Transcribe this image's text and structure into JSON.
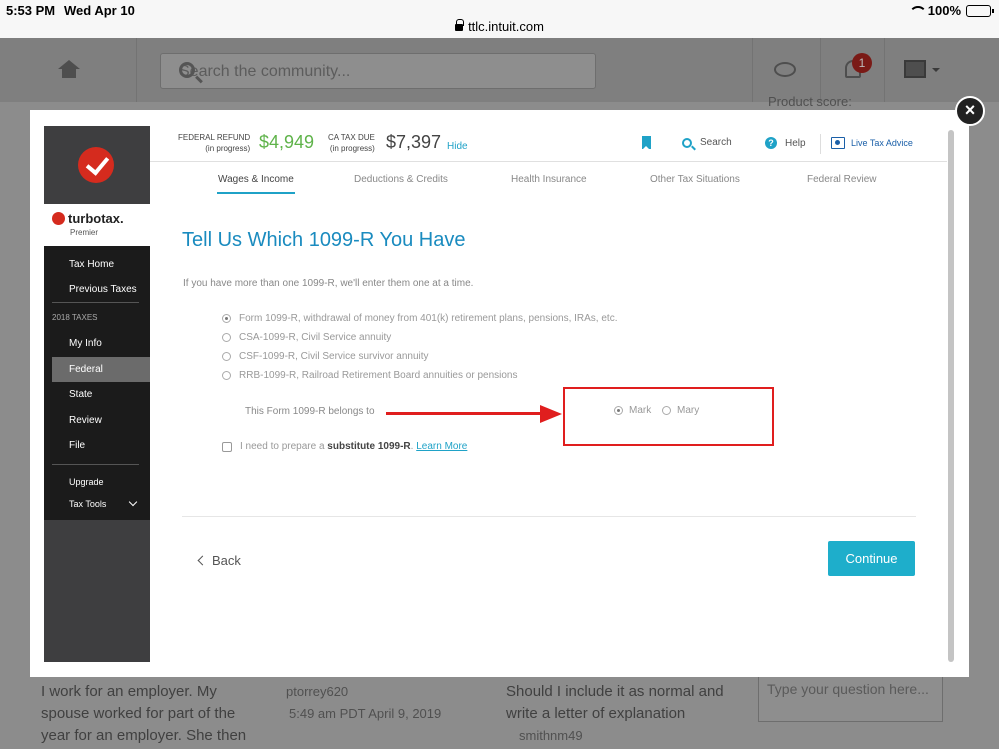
{
  "status_bar": {
    "time": "5:53 PM",
    "date": "Wed Apr 10",
    "url": "ttlc.intuit.com",
    "battery": "100%"
  },
  "background": {
    "search_placeholder": "Search the community...",
    "notification_count": "1",
    "product_score": "Product score:",
    "post1_lines": [
      "I work for an employer.  My",
      "spouse worked for part of the",
      "year for an employer.  She then"
    ],
    "post1_author": "ptorrey620",
    "post1_time": "5:49 am PDT April 9, 2019",
    "post2_lines": [
      "Should I include it as normal and",
      "write a letter of explanation"
    ],
    "post2_author": "smithnm49",
    "question_placeholder": "Type your question here..."
  },
  "modal": {
    "close_label": "×",
    "brand": {
      "name": "turbotax.",
      "edition": "Premier"
    },
    "sidebar": {
      "top_items": [
        "Tax Home",
        "Previous Taxes"
      ],
      "section": "2018 TAXES",
      "items": [
        "My Info",
        "Federal",
        "State",
        "Review",
        "File"
      ],
      "active_item": "Federal",
      "bottom_items": [
        "Upgrade",
        "Tax Tools"
      ]
    },
    "topbar": {
      "federal_label": "FEDERAL REFUND",
      "federal_sub": "(in progress)",
      "federal_amount": "$4,949",
      "ca_label": "CA TAX DUE",
      "ca_sub": "(in progress)",
      "ca_amount": "$7,397",
      "hide": "Hide",
      "search": "Search",
      "help": "Help",
      "advice": "Live Tax Advice",
      "refund_color": "#5fb34a"
    },
    "tabs": [
      "Wages & Income",
      "Deductions & Credits",
      "Health Insurance",
      "Other Tax Situations",
      "Federal Review"
    ],
    "active_tab": "Wages & Income",
    "title": "Tell Us Which 1099-R You Have",
    "intro": "If you have more than one 1099-R, we'll enter them one at a time.",
    "options": [
      "Form 1099-R, withdrawal of money from 401(k) retirement plans, pensions, IRAs, etc.",
      "CSA-1099-R, Civil Service annuity",
      "CSF-1099-R, Civil Service survivor annuity",
      "RRB-1099-R, Railroad Retirement Board annuities or pensions"
    ],
    "selected_option": 0,
    "belongs_label": "This Form 1099-R belongs to",
    "owners": [
      "Mark",
      "Mary"
    ],
    "selected_owner": "Mark",
    "substitute": {
      "prefix": "I need to prepare a ",
      "bold": "substitute 1099-R",
      "suffix": ". ",
      "link": "Learn More"
    },
    "back": "Back",
    "continue": "Continue",
    "accent_color": "#1eaecb",
    "annotation_color": "#e01e1e"
  }
}
